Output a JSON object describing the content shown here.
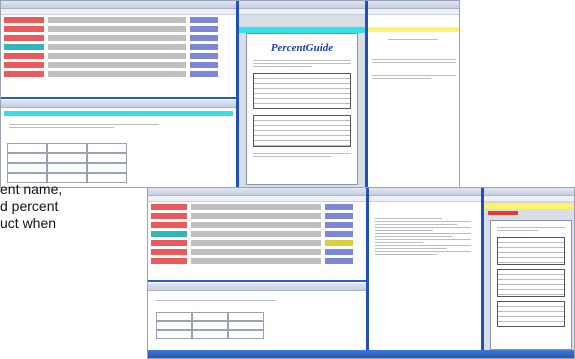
{
  "caption": {
    "lines": [
      "ent name,",
      "d percent",
      "uct when"
    ]
  },
  "doc_top": {
    "title": "PercentGuide"
  }
}
